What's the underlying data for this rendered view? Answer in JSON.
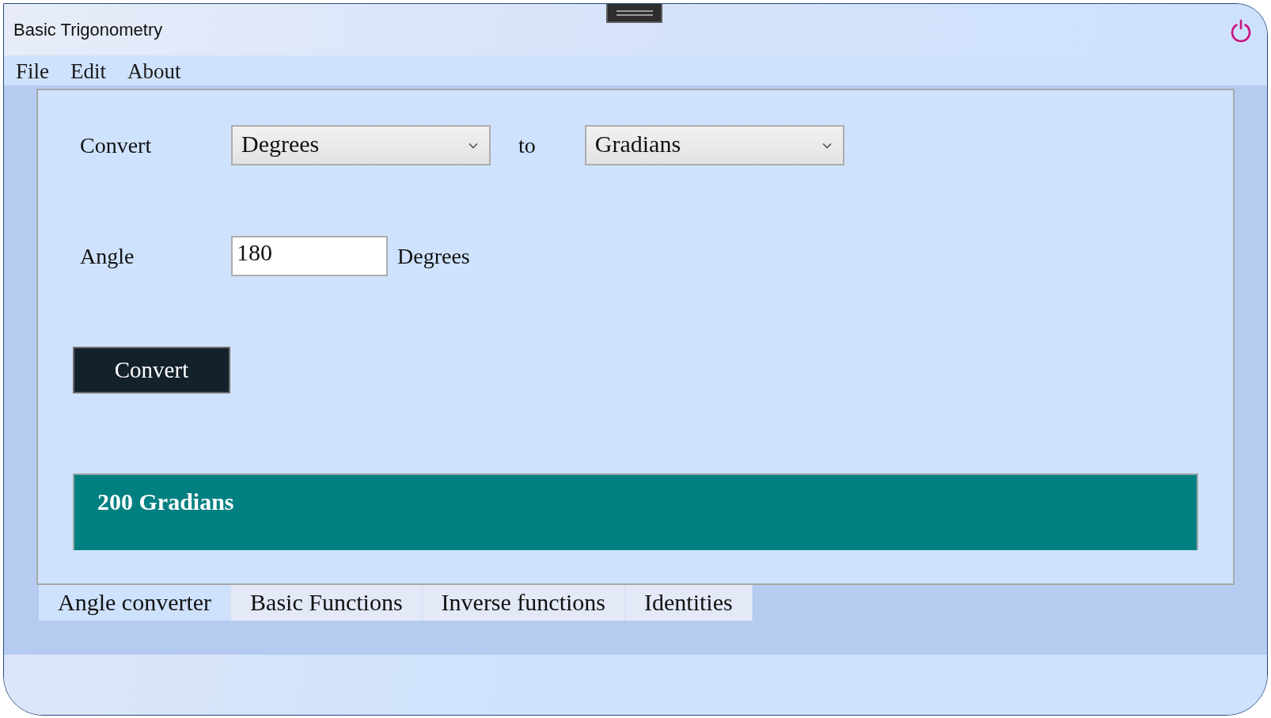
{
  "window": {
    "title": "Basic Trigonometry"
  },
  "menu": [
    "File",
    "Edit",
    "About"
  ],
  "converter": {
    "from_label": "Convert",
    "from_unit": "Degrees",
    "to_label": "to",
    "to_unit": "Gradians",
    "angle_label": "Angle",
    "angle_value": "180",
    "angle_unit": "Degrees",
    "button": "Convert",
    "result": "200 Gradians"
  },
  "tabs": [
    {
      "label": "Angle converter",
      "selected": true
    },
    {
      "label": "Basic Functions",
      "selected": false
    },
    {
      "label": "Inverse functions",
      "selected": false
    },
    {
      "label": "Identities",
      "selected": false
    }
  ]
}
